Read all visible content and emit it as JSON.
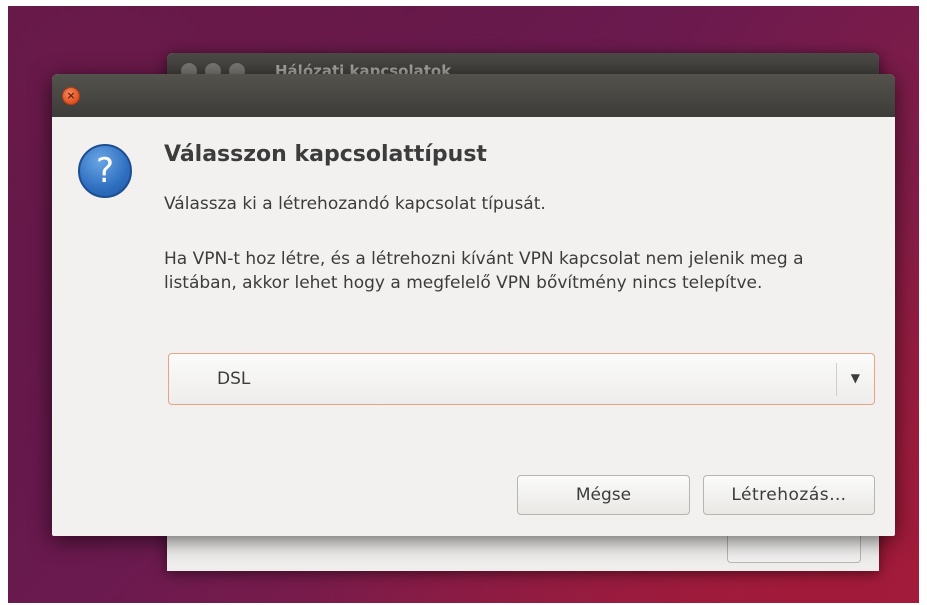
{
  "parent_window": {
    "title": "Hálózati kapcsolatok"
  },
  "dialog": {
    "close_glyph": "×",
    "icon": "question-icon",
    "icon_glyph": "?",
    "heading": "Válasszon kapcsolattípust",
    "subtext": "Válassza ki a létrehozandó kapcsolat típusát.",
    "info": "Ha VPN-t hoz létre, és a létrehozni kívánt VPN kapcsolat nem jelenik meg a listában, akkor lehet hogy a megfelelő VPN bővítmény nincs telepítve.",
    "connection_type": {
      "selected": "DSL",
      "arrow_glyph": "▼"
    },
    "buttons": {
      "cancel": "Mégse",
      "create": "Létrehozás…"
    }
  },
  "colors": {
    "desktop": "#6b1a4f",
    "titlebar": "#3d3c38",
    "close_button": "#e2501f",
    "dialog_bg": "#f2f1f0",
    "focus_border": "#e7a383"
  }
}
